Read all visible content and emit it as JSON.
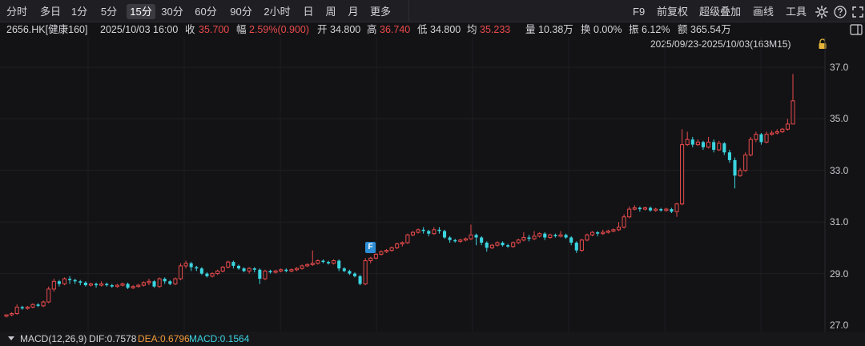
{
  "toolbar": {
    "timeframes": [
      "分时",
      "多日",
      "1分",
      "5分",
      "15分",
      "30分",
      "60分",
      "90分",
      "2小时",
      "日",
      "周",
      "月",
      "更多"
    ],
    "active_timeframe": "15分",
    "tools": {
      "f9": "F9",
      "adjust": "前复权",
      "overlay": "超级叠加",
      "draw": "画线",
      "tools": "工具"
    },
    "icons": [
      "settings-icon",
      "help-icon",
      "fullscreen-icon"
    ]
  },
  "quote": {
    "symbol": "2656.HK[健康160]",
    "datetime": "2025/10/03 16:00",
    "close_label": "收",
    "close": "35.700",
    "change_label": "幅",
    "change": "2.59%(0.900)",
    "open_label": "开",
    "open": "34.800",
    "high_label": "高",
    "high": "36.740",
    "low_label": "低",
    "low": "34.800",
    "avg_label": "均",
    "avg": "35.233",
    "volume_label": "量",
    "volume": "10.38万",
    "turnover_label": "换",
    "turnover": "0.00%",
    "amplitude_label": "振",
    "amplitude": "6.12%",
    "amount_label": "额",
    "amount": "365.54万"
  },
  "range_text": "2025/09/23-2025/10/03(163M15)",
  "marker": "F",
  "macd": {
    "name": "MACD(12,26,9)",
    "dif": "DIF:0.7578",
    "dea": "DEA:0.6796",
    "macd": "MACD:0.1564"
  },
  "colors": {
    "up": "#e84a4a",
    "down": "#3bd5e0",
    "background": "#131316",
    "dea": "#f29a3a"
  },
  "chart_data": {
    "type": "candlestick",
    "y_ticks": [
      "37.0",
      "35.0",
      "33.0",
      "31.0",
      "29.0",
      "27.0"
    ],
    "ylim": [
      26.6,
      37.6
    ],
    "grid": true,
    "candles": [
      [
        27.35,
        27.4,
        27.3,
        27.42
      ],
      [
        27.4,
        27.45,
        27.35,
        27.5
      ],
      [
        27.45,
        27.7,
        27.4,
        27.8
      ],
      [
        27.7,
        27.65,
        27.6,
        27.75
      ],
      [
        27.65,
        27.7,
        27.6,
        27.75
      ],
      [
        27.7,
        27.8,
        27.65,
        27.85
      ],
      [
        27.8,
        27.75,
        27.7,
        27.85
      ],
      [
        27.75,
        27.9,
        27.7,
        27.95
      ],
      [
        27.9,
        28.4,
        27.85,
        28.5
      ],
      [
        28.4,
        28.7,
        28.3,
        28.8
      ],
      [
        28.7,
        28.6,
        28.5,
        28.75
      ],
      [
        28.6,
        28.8,
        28.55,
        28.85
      ],
      [
        28.8,
        28.75,
        28.6,
        28.9
      ],
      [
        28.75,
        28.7,
        28.6,
        28.8
      ],
      [
        28.7,
        28.65,
        28.55,
        28.75
      ],
      [
        28.65,
        28.55,
        28.5,
        28.7
      ],
      [
        28.55,
        28.6,
        28.5,
        28.65
      ],
      [
        28.6,
        28.55,
        28.45,
        28.65
      ],
      [
        28.55,
        28.6,
        28.5,
        28.7
      ],
      [
        28.6,
        28.55,
        28.5,
        28.65
      ],
      [
        28.55,
        28.5,
        28.45,
        28.6
      ],
      [
        28.5,
        28.55,
        28.45,
        28.6
      ],
      [
        28.55,
        28.6,
        28.5,
        28.65
      ],
      [
        28.6,
        28.45,
        28.4,
        28.65
      ],
      [
        28.45,
        28.5,
        28.4,
        28.55
      ],
      [
        28.5,
        28.55,
        28.45,
        28.6
      ],
      [
        28.55,
        28.65,
        28.5,
        28.7
      ],
      [
        28.65,
        28.7,
        28.55,
        28.8
      ],
      [
        28.7,
        28.5,
        28.45,
        28.75
      ],
      [
        28.5,
        28.8,
        28.45,
        28.85
      ],
      [
        28.8,
        28.7,
        28.6,
        28.85
      ],
      [
        28.7,
        28.6,
        28.55,
        28.75
      ],
      [
        28.6,
        28.8,
        28.55,
        28.85
      ],
      [
        28.8,
        29.3,
        28.75,
        29.4
      ],
      [
        29.3,
        29.4,
        29.2,
        29.5
      ],
      [
        29.4,
        29.25,
        29.1,
        29.45
      ],
      [
        29.25,
        29.2,
        29.1,
        29.3
      ],
      [
        29.2,
        29.0,
        28.95,
        29.25
      ],
      [
        29.0,
        28.9,
        28.85,
        29.05
      ],
      [
        28.9,
        29.0,
        28.85,
        29.05
      ],
      [
        29.0,
        29.1,
        28.95,
        29.15
      ],
      [
        29.1,
        29.25,
        29.05,
        29.3
      ],
      [
        29.25,
        29.45,
        29.2,
        29.5
      ],
      [
        29.45,
        29.3,
        29.2,
        29.5
      ],
      [
        29.3,
        29.2,
        29.15,
        29.35
      ],
      [
        29.2,
        29.1,
        29.05,
        29.25
      ],
      [
        29.1,
        29.2,
        29.0,
        29.25
      ],
      [
        29.2,
        29.15,
        29.05,
        29.25
      ],
      [
        29.15,
        28.8,
        28.6,
        29.2
      ],
      [
        28.8,
        29.1,
        28.75,
        29.15
      ],
      [
        29.1,
        29.05,
        29.0,
        29.15
      ],
      [
        29.05,
        29.1,
        29.0,
        29.15
      ],
      [
        29.1,
        29.15,
        29.05,
        29.2
      ],
      [
        29.15,
        29.1,
        29.05,
        29.2
      ],
      [
        29.1,
        29.15,
        29.05,
        29.2
      ],
      [
        29.15,
        29.2,
        29.1,
        29.25
      ],
      [
        29.2,
        29.3,
        29.15,
        29.35
      ],
      [
        29.3,
        29.35,
        29.25,
        29.4
      ],
      [
        29.35,
        29.4,
        29.3,
        29.9
      ],
      [
        29.4,
        29.5,
        29.35,
        29.55
      ],
      [
        29.5,
        29.45,
        29.4,
        29.55
      ],
      [
        29.45,
        29.4,
        29.35,
        29.5
      ],
      [
        29.4,
        29.5,
        29.35,
        29.55
      ],
      [
        29.5,
        29.2,
        29.1,
        29.55
      ],
      [
        29.2,
        29.1,
        29.05,
        29.25
      ],
      [
        29.1,
        29.0,
        28.95,
        29.15
      ],
      [
        29.0,
        28.9,
        28.85,
        29.05
      ],
      [
        28.9,
        28.6,
        28.55,
        28.95
      ],
      [
        28.6,
        29.5,
        28.55,
        29.6
      ],
      [
        29.5,
        29.6,
        29.4,
        29.65
      ],
      [
        29.6,
        29.75,
        29.55,
        29.8
      ],
      [
        29.75,
        29.85,
        29.7,
        29.9
      ],
      [
        29.85,
        29.9,
        29.8,
        29.95
      ],
      [
        29.9,
        30.0,
        29.85,
        30.05
      ],
      [
        30.0,
        30.15,
        29.95,
        30.2
      ],
      [
        30.15,
        30.2,
        30.05,
        30.25
      ],
      [
        30.2,
        30.5,
        30.15,
        30.55
      ],
      [
        30.5,
        30.6,
        30.45,
        30.65
      ],
      [
        30.6,
        30.7,
        30.55,
        30.75
      ],
      [
        30.7,
        30.65,
        30.55,
        30.8
      ],
      [
        30.65,
        30.55,
        30.45,
        30.7
      ],
      [
        30.55,
        30.7,
        30.5,
        30.8
      ],
      [
        30.7,
        30.65,
        30.55,
        30.8
      ],
      [
        30.65,
        30.4,
        30.35,
        30.7
      ],
      [
        30.4,
        30.3,
        30.2,
        30.45
      ],
      [
        30.3,
        30.25,
        30.2,
        30.35
      ],
      [
        30.25,
        30.3,
        30.2,
        30.35
      ],
      [
        30.3,
        30.35,
        30.25,
        30.4
      ],
      [
        30.35,
        30.5,
        30.3,
        30.9
      ],
      [
        30.5,
        30.4,
        30.1,
        30.55
      ],
      [
        30.4,
        30.2,
        30.1,
        30.45
      ],
      [
        30.2,
        30.0,
        29.85,
        30.25
      ],
      [
        30.0,
        30.1,
        29.95,
        30.15
      ],
      [
        30.1,
        30.2,
        30.05,
        30.25
      ],
      [
        30.2,
        30.1,
        30.05,
        30.25
      ],
      [
        30.1,
        30.05,
        30.0,
        30.15
      ],
      [
        30.05,
        30.2,
        30.0,
        30.25
      ],
      [
        30.2,
        30.3,
        30.15,
        30.35
      ],
      [
        30.3,
        30.4,
        30.25,
        30.6
      ],
      [
        30.4,
        30.35,
        30.25,
        30.5
      ],
      [
        30.35,
        30.45,
        30.3,
        30.65
      ],
      [
        30.45,
        30.55,
        30.4,
        30.6
      ],
      [
        30.55,
        30.4,
        30.3,
        30.6
      ],
      [
        30.4,
        30.5,
        30.35,
        30.55
      ],
      [
        30.5,
        30.45,
        30.4,
        30.55
      ],
      [
        30.45,
        30.5,
        30.4,
        30.65
      ],
      [
        30.5,
        30.4,
        30.35,
        30.55
      ],
      [
        30.4,
        30.2,
        30.1,
        30.45
      ],
      [
        30.2,
        29.9,
        29.8,
        30.25
      ],
      [
        29.9,
        30.3,
        29.85,
        30.35
      ],
      [
        30.3,
        30.5,
        30.25,
        30.55
      ],
      [
        30.5,
        30.6,
        30.45,
        30.65
      ],
      [
        30.6,
        30.55,
        30.45,
        30.65
      ],
      [
        30.55,
        30.6,
        30.5,
        30.7
      ],
      [
        30.6,
        30.65,
        30.55,
        30.7
      ],
      [
        30.65,
        30.7,
        30.6,
        30.75
      ],
      [
        30.7,
        30.8,
        30.65,
        31.0
      ],
      [
        30.8,
        31.2,
        30.75,
        31.3
      ],
      [
        31.2,
        31.5,
        31.15,
        31.6
      ],
      [
        31.5,
        31.55,
        31.45,
        31.65
      ],
      [
        31.55,
        31.5,
        31.4,
        31.6
      ],
      [
        31.5,
        31.55,
        31.45,
        31.6
      ],
      [
        31.55,
        31.45,
        31.4,
        31.6
      ],
      [
        31.45,
        31.5,
        31.4,
        31.55
      ],
      [
        31.5,
        31.45,
        31.4,
        31.55
      ],
      [
        31.45,
        31.5,
        31.4,
        31.55
      ],
      [
        31.5,
        31.4,
        31.35,
        31.55
      ],
      [
        31.4,
        31.7,
        31.2,
        31.75
      ],
      [
        31.7,
        34.0,
        31.65,
        34.6
      ],
      [
        34.0,
        34.2,
        33.95,
        34.5
      ],
      [
        34.2,
        34.0,
        33.9,
        34.3
      ],
      [
        34.0,
        34.1,
        33.95,
        34.2
      ],
      [
        34.1,
        33.9,
        33.8,
        34.15
      ],
      [
        33.9,
        34.1,
        33.85,
        34.3
      ],
      [
        34.1,
        33.8,
        33.7,
        34.2
      ],
      [
        33.8,
        34.05,
        33.75,
        34.15
      ],
      [
        34.05,
        33.7,
        33.6,
        34.1
      ],
      [
        33.7,
        33.4,
        33.3,
        33.8
      ],
      [
        33.4,
        32.8,
        32.3,
        33.5
      ],
      [
        32.8,
        33.0,
        32.75,
        33.1
      ],
      [
        33.0,
        33.6,
        32.95,
        33.7
      ],
      [
        33.6,
        34.2,
        33.55,
        34.3
      ],
      [
        34.2,
        34.4,
        34.1,
        34.5
      ],
      [
        34.4,
        34.1,
        34.0,
        34.45
      ],
      [
        34.1,
        34.4,
        34.05,
        34.5
      ],
      [
        34.4,
        34.45,
        34.35,
        34.55
      ],
      [
        34.45,
        34.5,
        34.4,
        34.6
      ],
      [
        34.5,
        34.6,
        34.45,
        34.65
      ],
      [
        34.6,
        34.8,
        34.55,
        35.0
      ],
      [
        34.8,
        35.7,
        34.8,
        36.74
      ]
    ]
  }
}
